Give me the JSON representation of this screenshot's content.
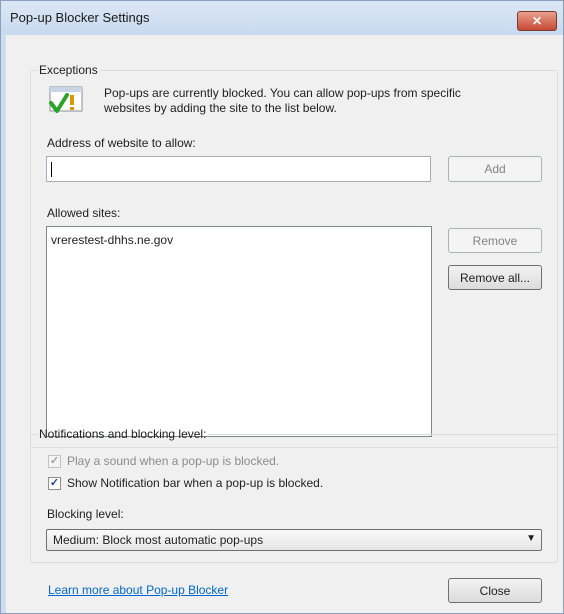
{
  "window": {
    "title": "Pop-up Blocker Settings",
    "close_glyph": "✕"
  },
  "exceptions": {
    "legend": "Exceptions",
    "message_line1": "Pop-ups are currently blocked.  You can allow pop-ups from specific",
    "message_line2": "websites by adding the site to the list below.",
    "address_label": "Address of website to allow:",
    "address_value": "",
    "add_label": "Add",
    "allowed_label": "Allowed sites:",
    "allowed_sites": [
      "vrerestest-dhhs.ne.gov"
    ],
    "remove_label": "Remove",
    "remove_all_label": "Remove all..."
  },
  "notifications": {
    "legend": "Notifications and blocking level:",
    "play_sound_label": "Play a sound when a pop-up is blocked.",
    "play_sound_checked": true,
    "play_sound_disabled": true,
    "show_bar_label": "Show Notification bar when a pop-up is blocked.",
    "show_bar_checked": true,
    "blocking_level_label": "Blocking level:",
    "blocking_level_value": "Medium: Block most automatic pop-ups"
  },
  "footer": {
    "learn_more": "Learn more about Pop-up Blocker",
    "close_label": "Close"
  },
  "colors": {
    "link": "#0066cc",
    "close_button": "#c64a34",
    "check_accent": "#1c3f91"
  },
  "icons": {
    "info": "info-check-icon",
    "dropdown": "chevron-down-icon"
  }
}
